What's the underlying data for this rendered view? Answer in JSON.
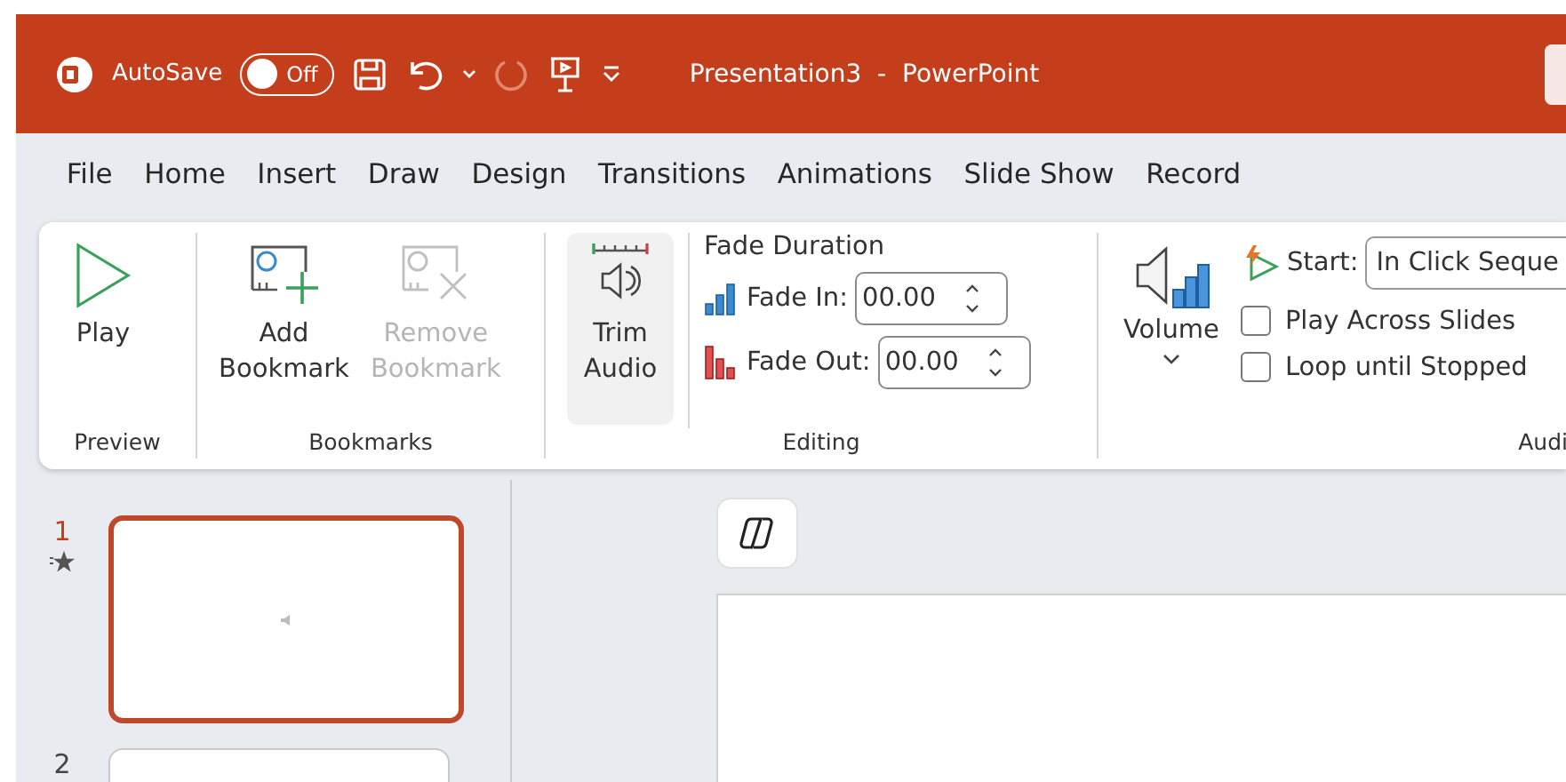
{
  "title_bar": {
    "autosave_label": "AutoSave",
    "autosave_toggle": {
      "label": "Off",
      "on": false
    },
    "document_title": "Presentation3  -  PowerPoint"
  },
  "menu_tabs": [
    {
      "label": "File",
      "selected": false
    },
    {
      "label": "Home",
      "selected": false
    },
    {
      "label": "Insert",
      "selected": false
    },
    {
      "label": "Draw",
      "selected": false
    },
    {
      "label": "Design",
      "selected": false
    },
    {
      "label": "Transitions",
      "selected": false
    },
    {
      "label": "Animations",
      "selected": false
    },
    {
      "label": "Slide Show",
      "selected": false
    },
    {
      "label": "Record",
      "selected": false
    }
  ],
  "ribbon": {
    "preview": {
      "label": "Preview",
      "play_label": "Play"
    },
    "bookmarks": {
      "label": "Bookmarks",
      "buttons": [
        {
          "kind": "add",
          "label": "Add Bookmark",
          "disabled": false
        },
        {
          "kind": "remove",
          "label": "Remove Bookmark",
          "disabled": true
        }
      ]
    },
    "editing": {
      "label": "Editing",
      "trim_label": "Trim Audio",
      "fade_heading": "Fade Duration",
      "fades": [
        {
          "kind": "in",
          "label": "Fade In:",
          "value": "00.00"
        },
        {
          "kind": "out",
          "label": "Fade Out:",
          "value": "00.00"
        }
      ]
    },
    "audio_options": {
      "label": "Audi",
      "volume_label": "Volume",
      "start_label": "Start:",
      "start_value": "In Click Seque",
      "checkboxes": [
        {
          "label": "Play Across Slides",
          "checked": false
        },
        {
          "label": "Loop until Stopped",
          "checked": false
        }
      ]
    }
  },
  "slides": [
    {
      "number": "1",
      "selected": true,
      "has_animation": true
    },
    {
      "number": "2",
      "selected": false
    }
  ]
}
